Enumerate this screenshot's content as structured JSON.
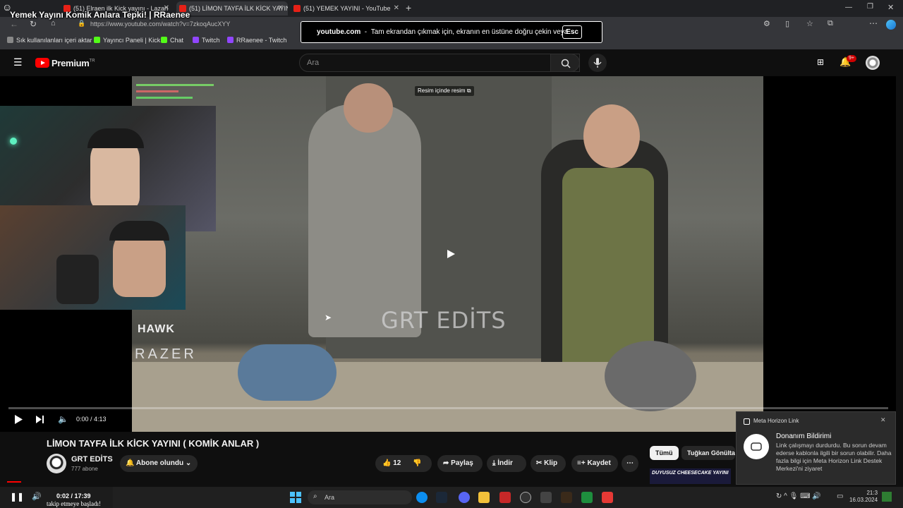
{
  "browser": {
    "tabs": [
      {
        "label": "(51) Elraen ilk Kick yayını - Lazarı",
        "active": false
      },
      {
        "label": "(51) LİMON TAYFA İLK KİCK YAYINI",
        "active": true
      },
      {
        "label": "(51) YEMEK YAYINI - YouTube",
        "active": false
      }
    ],
    "url": "https://www.youtube.com/watch?v=7zkoqAucXYY",
    "bookmarks": [
      "Sık kullanılanları içeri aktar",
      "Yayıncı Paneli | Kick",
      "Chat",
      "Twitch",
      "RRaenee - Twitch"
    ],
    "fullscreen_notice": {
      "site": "youtube.com",
      "message": "Tam ekrandan çıkmak için, ekranın en üstüne doğru çekin veya",
      "key": "Esc"
    }
  },
  "stream_overlay": {
    "title": "Yemek Yayını Komik Anlara Tepki! | RRaenee",
    "bottom_play_time": "0:02 / 17:39",
    "bottom_text": "takip etmeye başladı!"
  },
  "youtube": {
    "logo_text": "Premium",
    "logo_badge": "TR",
    "search_placeholder": "Ara",
    "notification_count": "9+",
    "pip_label": "Resim içinde resim",
    "watermark": "GRT EDİTS",
    "brand_left": "HAWK",
    "brand_left2": "RAZER",
    "player": {
      "time": "0:00 / 4:13",
      "progress": 0.0
    },
    "video_title": "LİMON TAYFA İLK KİCK YAYINI ( KOMİK ANLAR )",
    "channel": {
      "name": "GRT EDİTS",
      "subscribers": "777 abone"
    },
    "subscribe_label": "Abone olundu",
    "likes": "12",
    "share_label": "Paylaş",
    "download_label": "İndir",
    "clip_label": "Klip",
    "save_label": "Kaydet",
    "chips": [
      "Tümü",
      "Tuğkan Gönültaş"
    ],
    "thumbnail_caption": "DUYUSUZ CHEESECAKE YAYINI"
  },
  "notification": {
    "app": "Meta Horizon Link",
    "title": "Donanım Bildirimi",
    "body": "Link çalışmayı durdurdu. Bu sorun devam ederse kablonla ilgili bir sorun olabilir. Daha fazla bilgi için Meta Horizon Link Destek Merkezi'ni ziyaret"
  },
  "taskbar": {
    "search_placeholder": "Ara",
    "clock_time": "21:3",
    "clock_date": "16.03.2024"
  }
}
